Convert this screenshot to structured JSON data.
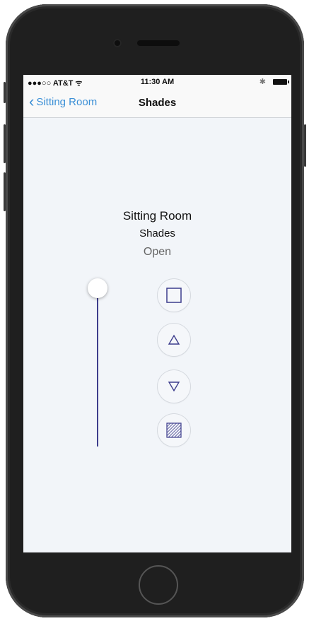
{
  "status_bar": {
    "carrier": "●●●○○ AT&T ᯤ",
    "time": "11:30 AM",
    "bluetooth": "✱"
  },
  "nav": {
    "back_label": "Sitting Room",
    "title": "Shades"
  },
  "device": {
    "room": "Sitting Room",
    "name": "Shades",
    "state": "Open"
  },
  "slider": {
    "level": 1.0
  },
  "controls": [
    {
      "name": "open-icon",
      "shape": "square-outline"
    },
    {
      "name": "raise-icon",
      "shape": "triangle-up"
    },
    {
      "name": "lower-icon",
      "shape": "triangle-down"
    },
    {
      "name": "close-icon",
      "shape": "hatched-square"
    }
  ],
  "colors": {
    "accent": "#3b8fd6",
    "control": "#3d3d8c"
  }
}
